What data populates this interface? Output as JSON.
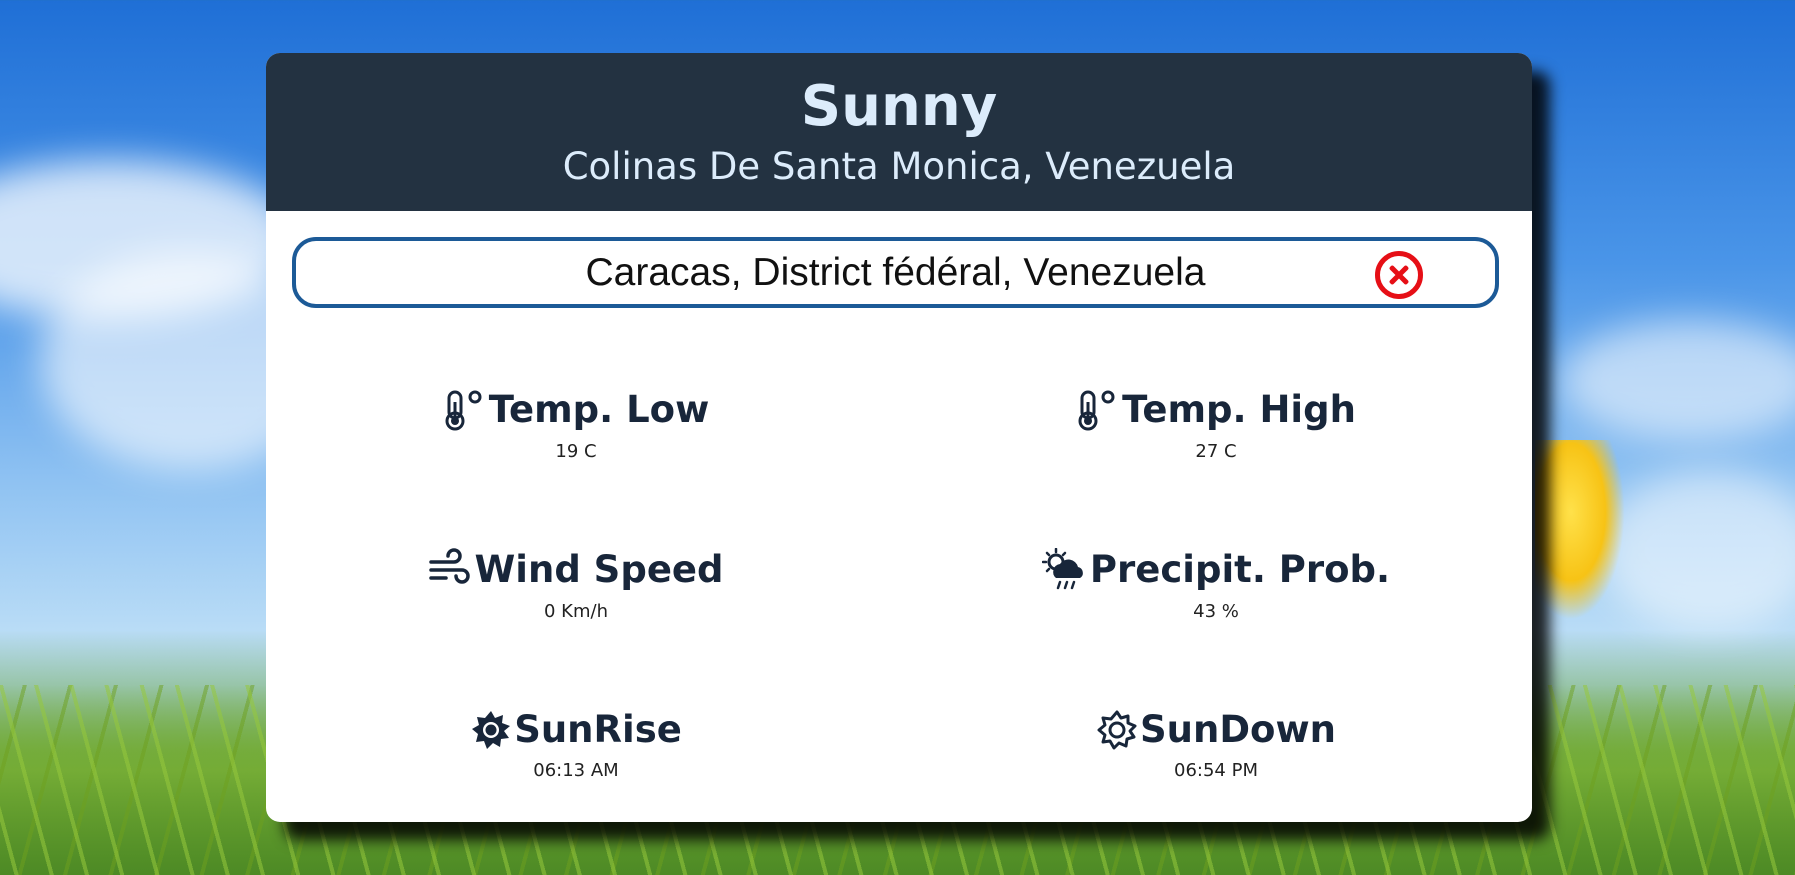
{
  "header": {
    "condition": "Sunny",
    "location": "Colinas De Santa Monica, Venezuela"
  },
  "search": {
    "value": "Caracas, District fédéral, Venezuela"
  },
  "stats": {
    "temp_low": {
      "label": "Temp. Low",
      "value": "19 C",
      "icon": "thermometer-icon"
    },
    "temp_high": {
      "label": "Temp. High",
      "value": "27 C",
      "icon": "thermometer-icon"
    },
    "wind_speed": {
      "label": "Wind Speed",
      "value": "0 Km/h",
      "icon": "wind-icon"
    },
    "precip_prob": {
      "label": "Precipit. Prob.",
      "value": "43 %",
      "icon": "sun-rain-cloud-icon"
    },
    "sunrise": {
      "label": "SunRise",
      "value": "06:13 AM",
      "icon": "sun-filled-icon"
    },
    "sundown": {
      "label": "SunDown",
      "value": "06:54 PM",
      "icon": "sun-outline-icon"
    }
  },
  "colors": {
    "header_bg": "#233241",
    "header_text": "#dcecfb",
    "search_border": "#1c5a97",
    "clear_button": "#e60f16",
    "stat_text": "#18263a"
  }
}
